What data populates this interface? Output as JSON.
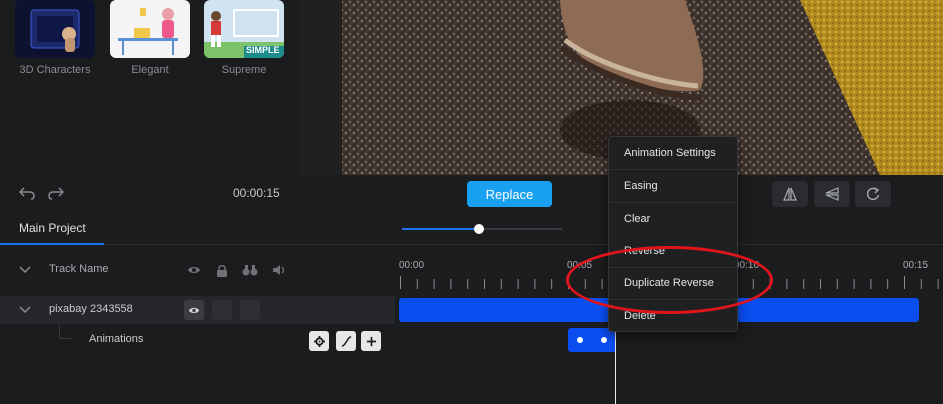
{
  "templates": [
    {
      "name": "3D Characters",
      "icon": "3d-characters-thumbnail"
    },
    {
      "name": "Elegant",
      "icon": "elegant-thumbnail"
    },
    {
      "name": "Supreme",
      "icon": "supreme-thumbnail",
      "thumb_text": "SIMPLE"
    }
  ],
  "toolbar": {
    "time": "00:00:15",
    "replace_label": "Replace"
  },
  "tabs": {
    "main": "Main Project"
  },
  "zoom": {
    "level": 0.48
  },
  "track_header": {
    "label": "Track Name"
  },
  "track": {
    "name": "pixabay 2343558"
  },
  "animations_row": {
    "label": "Animations"
  },
  "ruler": {
    "ticks": [
      "00:00",
      "00:05",
      "00:10",
      "00:15"
    ]
  },
  "context_menu": {
    "items": [
      "Animation Settings",
      "Easing",
      "Clear",
      "Reverse",
      "Duplicate Reverse",
      "Delete"
    ]
  },
  "colors": {
    "accent": "#1d6ff2",
    "replace": "#19a0f0",
    "clip": "#0a4ef0",
    "annotation": "#e0141b"
  }
}
